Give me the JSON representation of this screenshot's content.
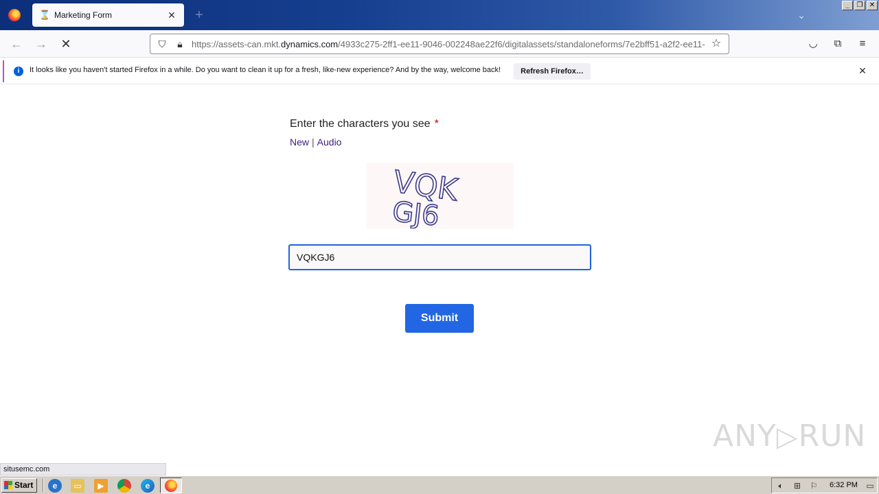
{
  "browser": {
    "tab_title": "Marketing Form",
    "new_tab_symbol": "+",
    "url_prefix": "https://assets-can.mkt.",
    "url_host": "dynamics.com",
    "url_path": "/4933c275-2ff1-ee11-9046-002248ae22f6/digitalassets/standaloneforms/7e2bff51-a2f2-ee11-",
    "status_text": "situsemc.com",
    "window_buttons": [
      "_",
      "❐",
      "✕"
    ]
  },
  "notification": {
    "message": "It looks like you haven't started Firefox in a while. Do you want to clean it up for a fresh, like-new experience? And by the way, welcome back!",
    "button_label": "Refresh Firefox…"
  },
  "form": {
    "captcha_label": "Enter the characters you see",
    "required_marker": "*",
    "link_new": "New",
    "link_separator": "|",
    "link_audio": "Audio",
    "captcha_line1": "VQK",
    "captcha_line2": "GJ6",
    "input_value": "VQKGJ6",
    "submit_label": "Submit"
  },
  "watermark": {
    "text_left": "ANY",
    "text_right": "RUN"
  },
  "taskbar": {
    "start_label": "Start",
    "clock": "6:32 PM"
  },
  "colors": {
    "submit_bg": "#2266e3",
    "input_border": "#1e63e0",
    "required": "#c00000"
  },
  "icons": {
    "tab_icon": "hourglass-icon",
    "reload_state": "stop-icon"
  }
}
